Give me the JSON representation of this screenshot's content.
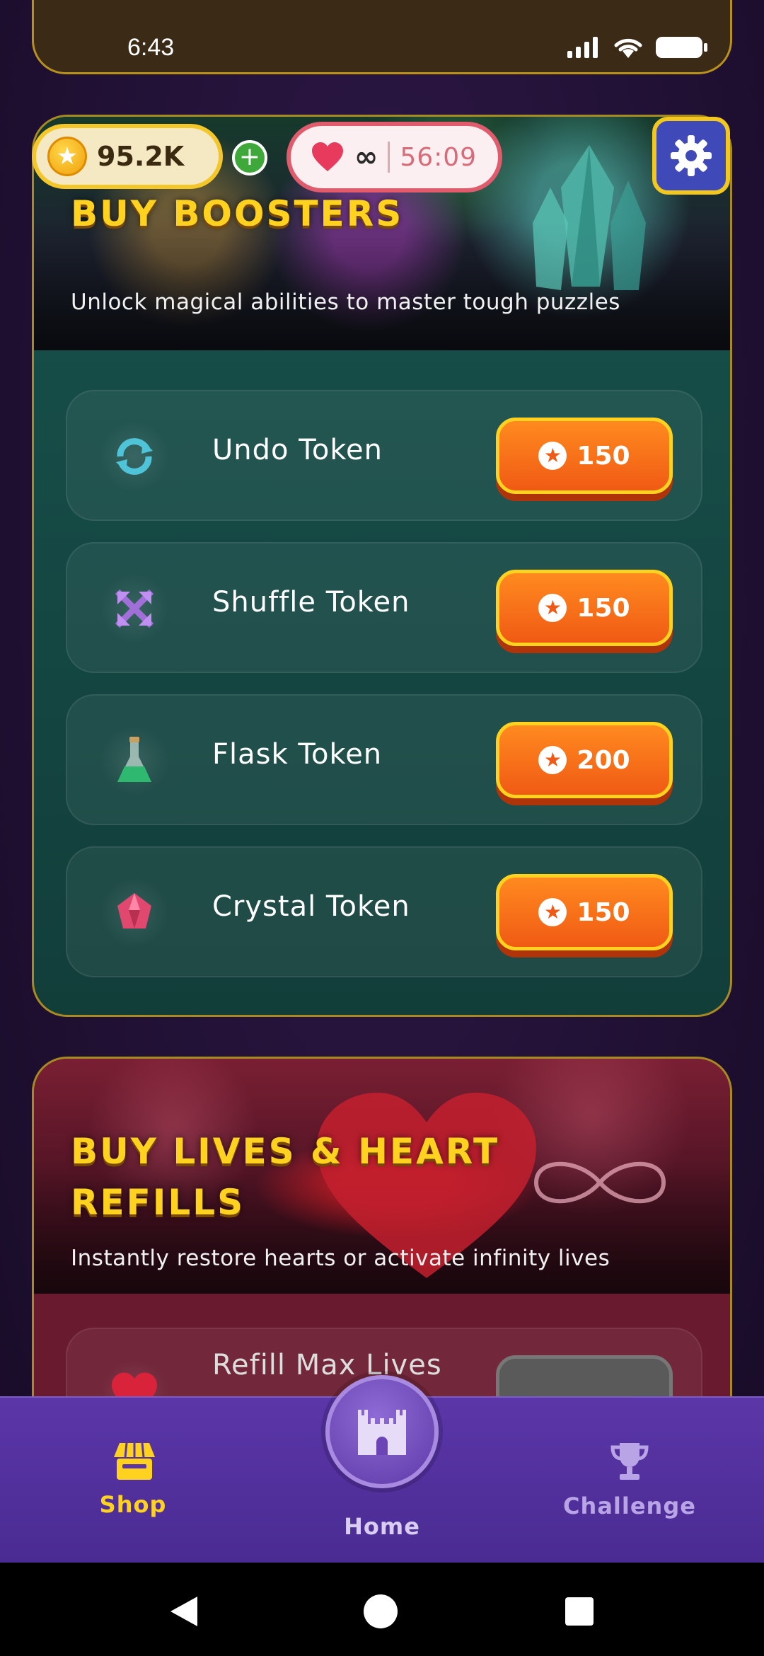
{
  "status_bar": {
    "time": "6:43"
  },
  "hud": {
    "coins": "95.2K",
    "add_coins_symbol": "+",
    "lives_value": "∞",
    "lives_timer": "56:09"
  },
  "boosters": {
    "title": "BUY BOOSTERS",
    "subtitle": "Unlock magical abilities to master tough puzzles",
    "items": [
      {
        "label": "Undo Token",
        "price": "150",
        "icon": "undo-arrows-icon"
      },
      {
        "label": "Shuffle Token",
        "price": "150",
        "icon": "shuffle-arrows-icon"
      },
      {
        "label": "Flask Token",
        "price": "200",
        "icon": "flask-icon"
      },
      {
        "label": "Crystal Token",
        "price": "150",
        "icon": "crystal-gem-icon"
      }
    ]
  },
  "lives": {
    "title_line1": "BUY LIVES & HEART",
    "title_line2": "REFILLS",
    "subtitle": "Instantly restore hearts or activate infinity lives",
    "first_item_label": "Refill Max Lives"
  },
  "bottom_nav": {
    "shop": "Shop",
    "home": "Home",
    "challenge": "Challenge"
  },
  "colors": {
    "accent_gold": "#ffd21f",
    "price_orange": "#f05a14",
    "nav_purple": "#5b36a8",
    "boosters_teal": "#18524d",
    "lives_red": "#6a1a2e"
  }
}
